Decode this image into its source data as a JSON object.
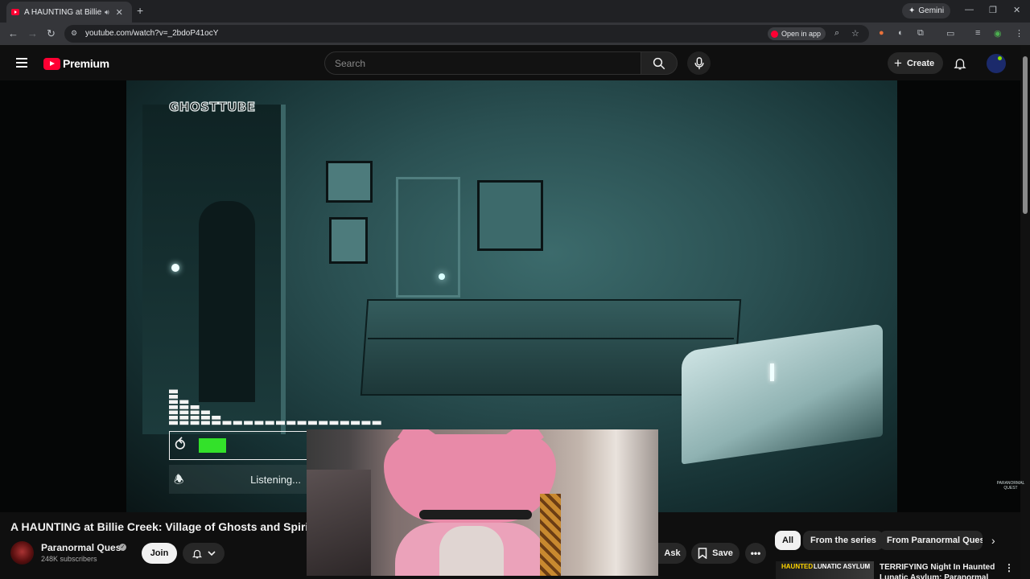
{
  "browser": {
    "tab_title": "A HAUNTING at Billie Creek",
    "sound_icon": "speaker-icon",
    "url": "youtube.com/watch?v=_2bdoP41ocY",
    "open_in_app": "Open in app",
    "gemini": "Gemini"
  },
  "masthead": {
    "logo_text": "Premium",
    "search_placeholder": "Search",
    "create_label": "Create"
  },
  "video_overlay": {
    "brand": "GHOSTTUBE",
    "magnetometer_level": 0.2,
    "status_text": "Listening...",
    "watermark": "PARANORMAL QUEST"
  },
  "video": {
    "title": "A HAUNTING at Billie Creek: Village of Ghosts and Spirits",
    "channel_name": "Paranormal Quest",
    "subscribers": "248K subscribers",
    "join_label": "Join",
    "ask_label": "Ask",
    "save_label": "Save"
  },
  "chips": [
    "All",
    "From the series",
    "From Paranormal Quest"
  ],
  "recommendation": {
    "thumb_word1": "HAUNTED",
    "thumb_word2": "LUNATIC ASYLUM",
    "title": "TERRIFYING Night In Haunted Lunatic Asylum: Paranormal"
  },
  "colors": {
    "youtube_red": "#ff0033",
    "meter_green": "#33e12a",
    "background": "#0f0f0f"
  }
}
